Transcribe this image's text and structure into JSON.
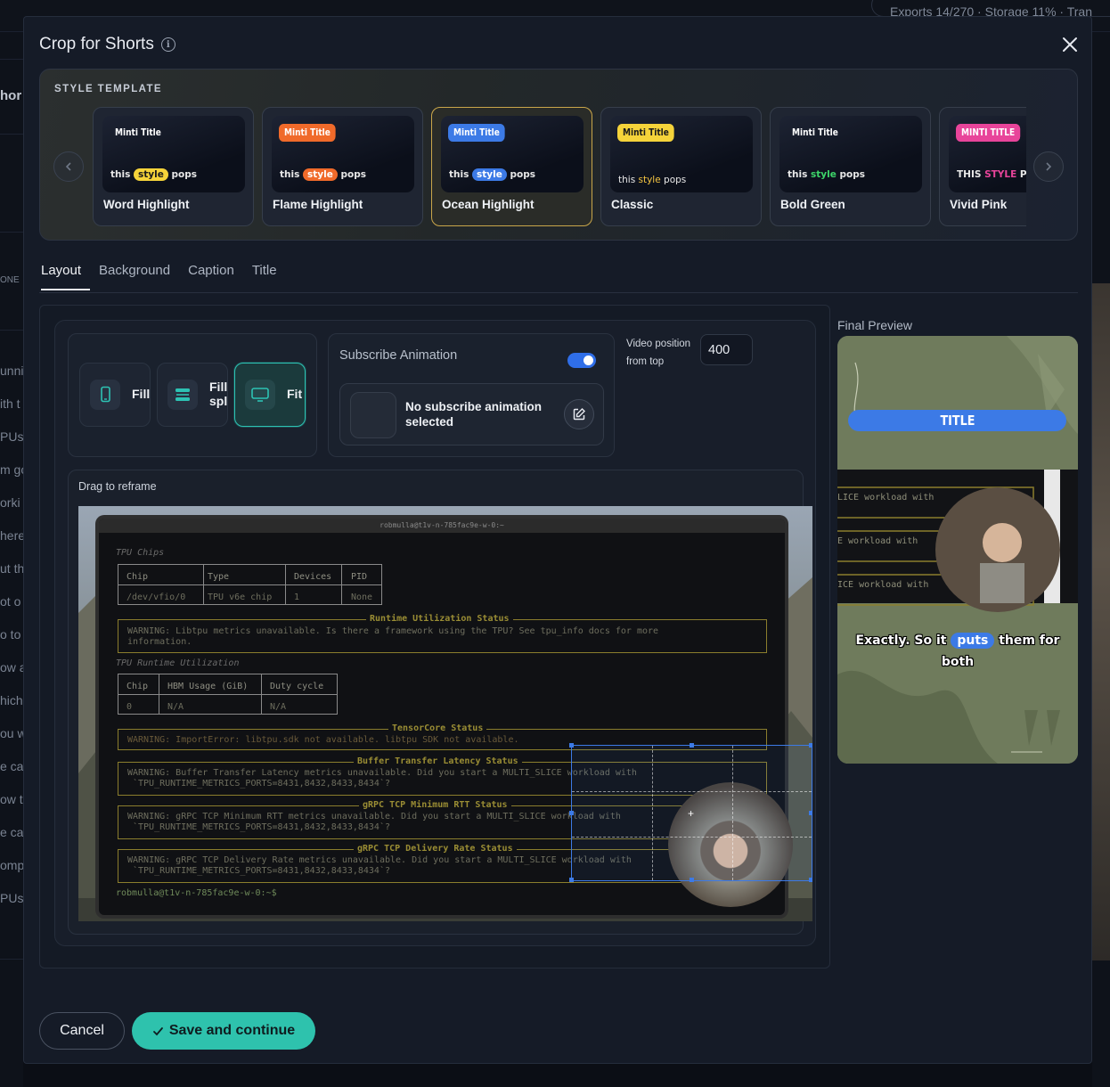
{
  "background": {
    "status_pill": "Exports 14/270 · Storage 11% · Tran",
    "left_snippets": [
      "hor",
      "ONE",
      "unni",
      "ith t",
      "PUs",
      "m go",
      "orki",
      "here",
      "ut th",
      "ot o",
      "o to",
      "ow a",
      "hich",
      "ou w",
      "e ca",
      "ow t",
      "e ca",
      "omp",
      "PUs"
    ]
  },
  "modal": {
    "title": "Crop for Shorts",
    "info_icon": "info-icon",
    "close_icon": "close-icon"
  },
  "templates": {
    "heading": "STYLE TEMPLATE",
    "prev_icon": "chevron-left-icon",
    "next_icon": "chevron-right-icon",
    "items": [
      {
        "name": "Word Highlight",
        "badge": "Minti Title",
        "badge_bg": "transparent",
        "badge_color": "#ffffff",
        "caption_pre": "this ",
        "caption_hl": "style",
        "caption_post": " pops",
        "hl_bg": "#f5d33a",
        "hl_color": "#1a1a1a",
        "selected": false
      },
      {
        "name": "Flame Highlight",
        "badge": "Minti Title",
        "badge_bg": "#f06a2a",
        "badge_color": "#ffffff",
        "caption_pre": "this ",
        "caption_hl": "style",
        "caption_post": " pops",
        "hl_bg": "#f06a2a",
        "hl_color": "#ffffff",
        "selected": false
      },
      {
        "name": "Ocean Highlight",
        "badge": "Minti Title",
        "badge_bg": "#3c7ae6",
        "badge_color": "#ffffff",
        "caption_pre": "this ",
        "caption_hl": "style",
        "caption_post": " pops",
        "hl_bg": "#3c7ae6",
        "hl_color": "#ffffff",
        "selected": true
      },
      {
        "name": "Classic",
        "badge": "Minti Title",
        "badge_bg": "#f5d33a",
        "badge_color": "#1a1a1a",
        "caption_pre": "this ",
        "caption_hl": "style",
        "caption_post": " pops",
        "hl_bg": "transparent",
        "hl_color": "#f5c542",
        "selected": false
      },
      {
        "name": "Bold Green",
        "badge": "Minti Title",
        "badge_bg": "transparent",
        "badge_color": "#ffffff",
        "caption_pre": "this ",
        "caption_hl": "style",
        "caption_post": " pops",
        "hl_bg": "transparent",
        "hl_color": "#3dd66a",
        "selected": false
      },
      {
        "name": "Vivid Pink",
        "badge": "MINTI TITLE",
        "badge_bg": "#e8449a",
        "badge_color": "#ffffff",
        "caption_pre": "THIS ",
        "caption_hl": "STYLE",
        "caption_post": " POPS",
        "hl_bg": "transparent",
        "hl_color": "#e8449a",
        "selected": false
      }
    ]
  },
  "tabs": [
    {
      "label": "Layout",
      "active": true
    },
    {
      "label": "Background",
      "active": false
    },
    {
      "label": "Caption",
      "active": false
    },
    {
      "label": "Title",
      "active": false
    }
  ],
  "layout": {
    "options": [
      {
        "label": "Fill",
        "icon": "phone-icon",
        "selected": false
      },
      {
        "label": "Fill split",
        "icon": "split-icon",
        "selected": false
      },
      {
        "label": "Fit",
        "icon": "monitor-icon",
        "selected": true
      }
    ],
    "subscribe": {
      "title": "Subscribe Animation",
      "enabled": true,
      "none_text": "No subscribe animation selected",
      "edit_icon": "edit-icon"
    },
    "video_position": {
      "label": "Video position from top",
      "value": "400"
    },
    "reframe_label": "Drag to reframe"
  },
  "terminal": {
    "title": "robmulla@t1v-n-785fac9e-w-0:~",
    "section_chips": "TPU Chips",
    "chips_headers": [
      "Chip",
      "Type",
      "Devices",
      "PID"
    ],
    "chips_row": [
      "/dev/vfio/0",
      "TPU v6e chip",
      "1",
      "None"
    ],
    "runtime_status_title": "Runtime Utilization Status",
    "runtime_warning_1": "WARNING: Libtpu metrics unavailable. Is there a framework using the TPU? See tpu_info docs for more",
    "runtime_warning_2": "information.",
    "section_runtime": "TPU Runtime Utilization",
    "util_headers": [
      "Chip",
      "HBM Usage (GiB)",
      "Duty cycle"
    ],
    "util_row": [
      "0",
      "N/A",
      "N/A"
    ],
    "tensorcore_title": "TensorCore Status",
    "tensorcore_warning": "WARNING: ImportError: libtpu.sdk not available. libtpu SDK not available.",
    "buffer_title": "Buffer Transfer Latency Status",
    "buffer_warning_1": "WARNING: Buffer Transfer Latency metrics unavailable. Did you start a MULTI_SLICE workload with",
    "buffer_warning_2": "`TPU_RUNTIME_METRICS_PORTS=8431,8432,8433,8434`?",
    "grpc_rtt_title": "gRPC TCP Minimum RTT Status",
    "grpc_rtt_warning_1": "WARNING: gRPC TCP Minimum RTT metrics unavailable. Did you start a MULTI_SLICE workload with",
    "grpc_rtt_warning_2": "`TPU_RUNTIME_METRICS_PORTS=8431,8432,8433,8434`?",
    "grpc_rate_title": "gRPC TCP Delivery Rate Status",
    "grpc_rate_warning_1": "WARNING: gRPC TCP Delivery Rate metrics unavailable. Did you start a MULTI_SLICE workload with",
    "grpc_rate_warning_2": "`TPU_RUNTIME_METRICS_PORTS=8431,8432,8433,8434`?",
    "prompt": "robmulla@t1v-n-785fac9e-w-0:~$"
  },
  "preview": {
    "label": "Final Preview",
    "title_text": "TITLE",
    "terminal_lines": [
      "LICE workload with",
      "E workload with",
      "ICE workload with"
    ],
    "caption_pre": "Exactly. So it ",
    "caption_hl": "puts",
    "caption_post": " them for both"
  },
  "footer": {
    "cancel": "Cancel",
    "save": "Save and continue",
    "save_icon": "check-icon"
  }
}
